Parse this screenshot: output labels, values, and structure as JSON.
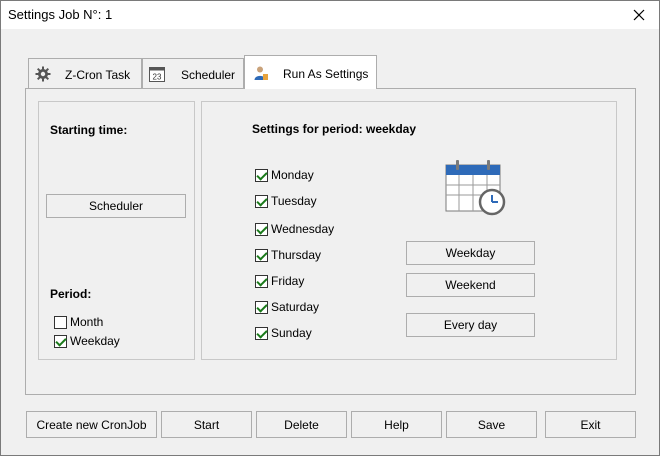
{
  "window": {
    "title": "Settings Job N°: 1"
  },
  "tabs": [
    {
      "label": "Z-Cron Task",
      "icon": "gear-icon"
    },
    {
      "label": "Scheduler",
      "icon": "calendar-23-icon",
      "icon_text": "23"
    },
    {
      "label": "Run As Settings",
      "icon": "user-icon",
      "active": true
    }
  ],
  "left_panel": {
    "starting_time_label": "Starting time:",
    "scheduler_button": "Scheduler",
    "period_label": "Period:",
    "period_options": [
      {
        "label": "Month",
        "checked": false
      },
      {
        "label": "Weekday",
        "checked": true
      }
    ]
  },
  "right_panel": {
    "heading": "Settings for period: weekday",
    "days": [
      {
        "label": "Monday",
        "checked": true
      },
      {
        "label": "Tuesday",
        "checked": true
      },
      {
        "label": "Wednesday",
        "checked": true
      },
      {
        "label": "Thursday",
        "checked": true
      },
      {
        "label": "Friday",
        "checked": true
      },
      {
        "label": "Saturday",
        "checked": true
      },
      {
        "label": "Sunday",
        "checked": true
      }
    ],
    "buttons": {
      "weekday": "Weekday",
      "weekend": "Weekend",
      "every_day": "Every day"
    }
  },
  "footer": {
    "create": "Create new CronJob",
    "start": "Start",
    "delete": "Delete",
    "help": "Help",
    "save": "Save",
    "exit": "Exit"
  },
  "colors": {
    "accent": "#2e6ab8",
    "check": "#1a7a1a"
  }
}
